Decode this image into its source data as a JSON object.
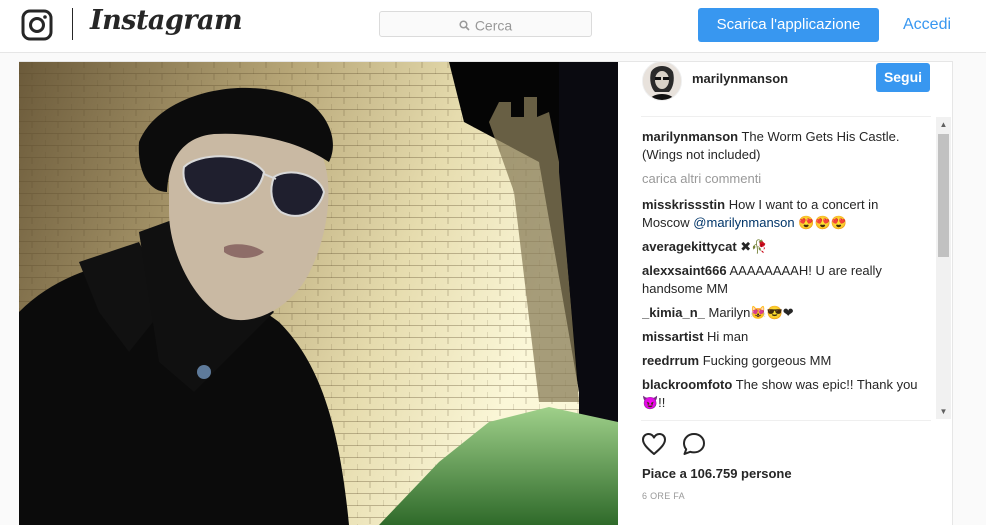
{
  "topbar": {
    "logo_text": "Instagram",
    "search_placeholder": "Cerca",
    "app_button": "Scarica l'applicazione",
    "login_link": "Accedi"
  },
  "post": {
    "username": "marilynmanson",
    "follow_button": "Segui",
    "caption_user": "marilynmanson",
    "caption_text": "The Worm Gets His Castle. (Wings not included)",
    "load_more": "carica altri commenti",
    "comments": [
      {
        "user": "misskrissstin",
        "text": "How I want to a concert in Moscow ",
        "mention": "@marilynmanson",
        "tail": " 😍😍😍"
      },
      {
        "user": "averagekittycat",
        "text": "✖🥀"
      },
      {
        "user": "alexxsaint666",
        "text": "AAAAAAAAH! U are really handsome MM"
      },
      {
        "user": "_kimia_n_",
        "text": "Marilyn😻😎❤"
      },
      {
        "user": "missartist",
        "text": "Hi man"
      },
      {
        "user": "reedrrum",
        "text": "Fucking gorgeous MM"
      },
      {
        "user": "blackroomfoto",
        "text": "The show was epic!! Thank you😈!!"
      }
    ],
    "likes_text": "Piace a 106.759 persone",
    "time_text": "6 ORE FA"
  },
  "icons": {
    "logo": "instagram-camera-icon",
    "search": "magnifier-icon",
    "like": "heart-outline-icon",
    "comment": "speech-bubble-icon"
  },
  "colors": {
    "accent": "#3897f0",
    "text": "#262626",
    "muted": "#999999",
    "mention": "#003569"
  }
}
